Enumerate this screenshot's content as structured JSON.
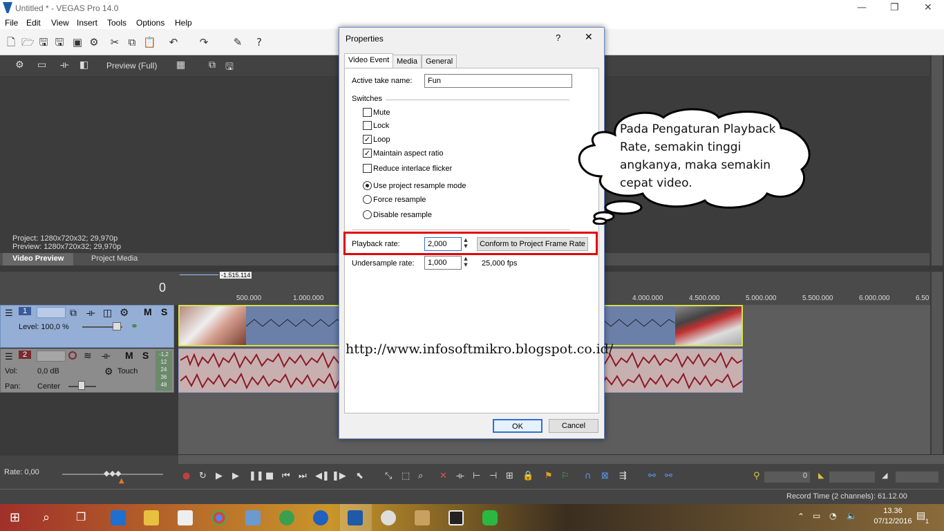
{
  "window": {
    "title": "Untitled * - VEGAS Pro 14.0"
  },
  "menu": [
    "File",
    "Edit",
    "View",
    "Insert",
    "Tools",
    "Options",
    "Help"
  ],
  "preview": {
    "mode": "Preview (Full)",
    "project_info": "Project:   1280x720x32; 29,970p",
    "preview_info": "Preview:  1280x720x32; 29,970p",
    "tabs": [
      "Video Preview",
      "Project Media"
    ]
  },
  "timeline": {
    "counter": "0",
    "position_label": "-1.515.114",
    "ticks": [
      "500.000",
      "1.000.000",
      "4.000.000",
      "4.500.000",
      "5.000.000",
      "5.500.000",
      "6.000.000",
      "6.50"
    ],
    "video_track": {
      "number": "1",
      "level": "Level: 100,0 %",
      "m": "M",
      "s": "S"
    },
    "audio_track": {
      "number": "2",
      "vol_label": "Vol:",
      "vol": "0,0 dB",
      "pan_label": "Pan:",
      "pan": "Center",
      "mode": "Touch",
      "m": "M",
      "s": "S",
      "meter": [
        "-1,2",
        "12",
        "24",
        "36",
        "48"
      ]
    },
    "rate": "Rate: 0,00",
    "cursor_time": "0"
  },
  "status": {
    "record_time": "Record Time (2 channels): 61.12.00"
  },
  "taskbar": {
    "time": "13.36",
    "date": "07/12/2016",
    "notifications": "1"
  },
  "dialog": {
    "title": "Properties",
    "help": "?",
    "close": "✕",
    "tabs": [
      "Video Event",
      "Media",
      "General"
    ],
    "active_take_label": "Active take name:",
    "active_take_value": "Fun",
    "switches_label": "Switches",
    "checkboxes": [
      {
        "label": "Mute",
        "checked": false
      },
      {
        "label": "Lock",
        "checked": false
      },
      {
        "label": "Loop",
        "checked": true
      },
      {
        "label": "Maintain aspect ratio",
        "checked": true
      },
      {
        "label": "Reduce interlace flicker",
        "checked": false
      }
    ],
    "radios": [
      {
        "label": "Use project resample mode",
        "selected": true
      },
      {
        "label": "Force resample",
        "selected": false
      },
      {
        "label": "Disable resample",
        "selected": false
      }
    ],
    "playback_rate_label": "Playback rate:",
    "playback_rate_value": "2,000",
    "conform_button": "Conform to Project Frame Rate",
    "undersample_label": "Undersample rate:",
    "undersample_value": "1,000",
    "fps": "25,000 fps",
    "ok": "OK",
    "cancel": "Cancel"
  },
  "annotation": {
    "bubble_text": "Pada Pengaturan Playback Rate, semakin tinggi angkanya, maka semakin cepat video.",
    "url": "http://www.infosoftmikro.blogspot.co.id/",
    "highlight_color": "#e00000"
  }
}
